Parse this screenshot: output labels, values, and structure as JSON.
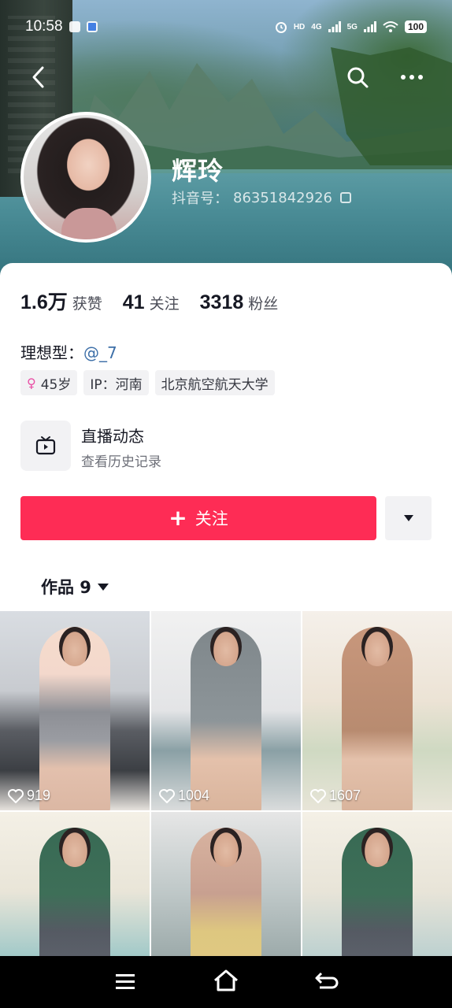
{
  "status_bar": {
    "time": "10:58",
    "network_hd": "HD",
    "network_4g": "4G",
    "network_5g": "5G",
    "battery": "100"
  },
  "profile": {
    "nickname": "辉玲",
    "douyin_id_label": "抖音号：",
    "douyin_id": "86351842926"
  },
  "stats": [
    {
      "num": "1.6万",
      "label": "获赞"
    },
    {
      "num": "41",
      "label": "关注"
    },
    {
      "num": "3318",
      "label": "粉丝"
    }
  ],
  "bio": {
    "prefix": "理想型：",
    "mention": "@_7"
  },
  "tags": {
    "age": "45岁",
    "ip": "IP：河南",
    "school": "北京航空航天大学"
  },
  "live": {
    "title": "直播动态",
    "subtitle": "查看历史记录"
  },
  "actions": {
    "follow_label": "关注",
    "follow_plus": "+"
  },
  "works": {
    "tab_label": "作品 9"
  },
  "videos": [
    {
      "likes": "919"
    },
    {
      "likes": "1004"
    },
    {
      "likes": "1607"
    },
    {
      "likes": ""
    },
    {
      "likes": ""
    },
    {
      "likes": ""
    }
  ],
  "colors": {
    "accent": "#fe2c55",
    "mention": "#3d6fa8",
    "female_icon": "#e94fa5"
  }
}
